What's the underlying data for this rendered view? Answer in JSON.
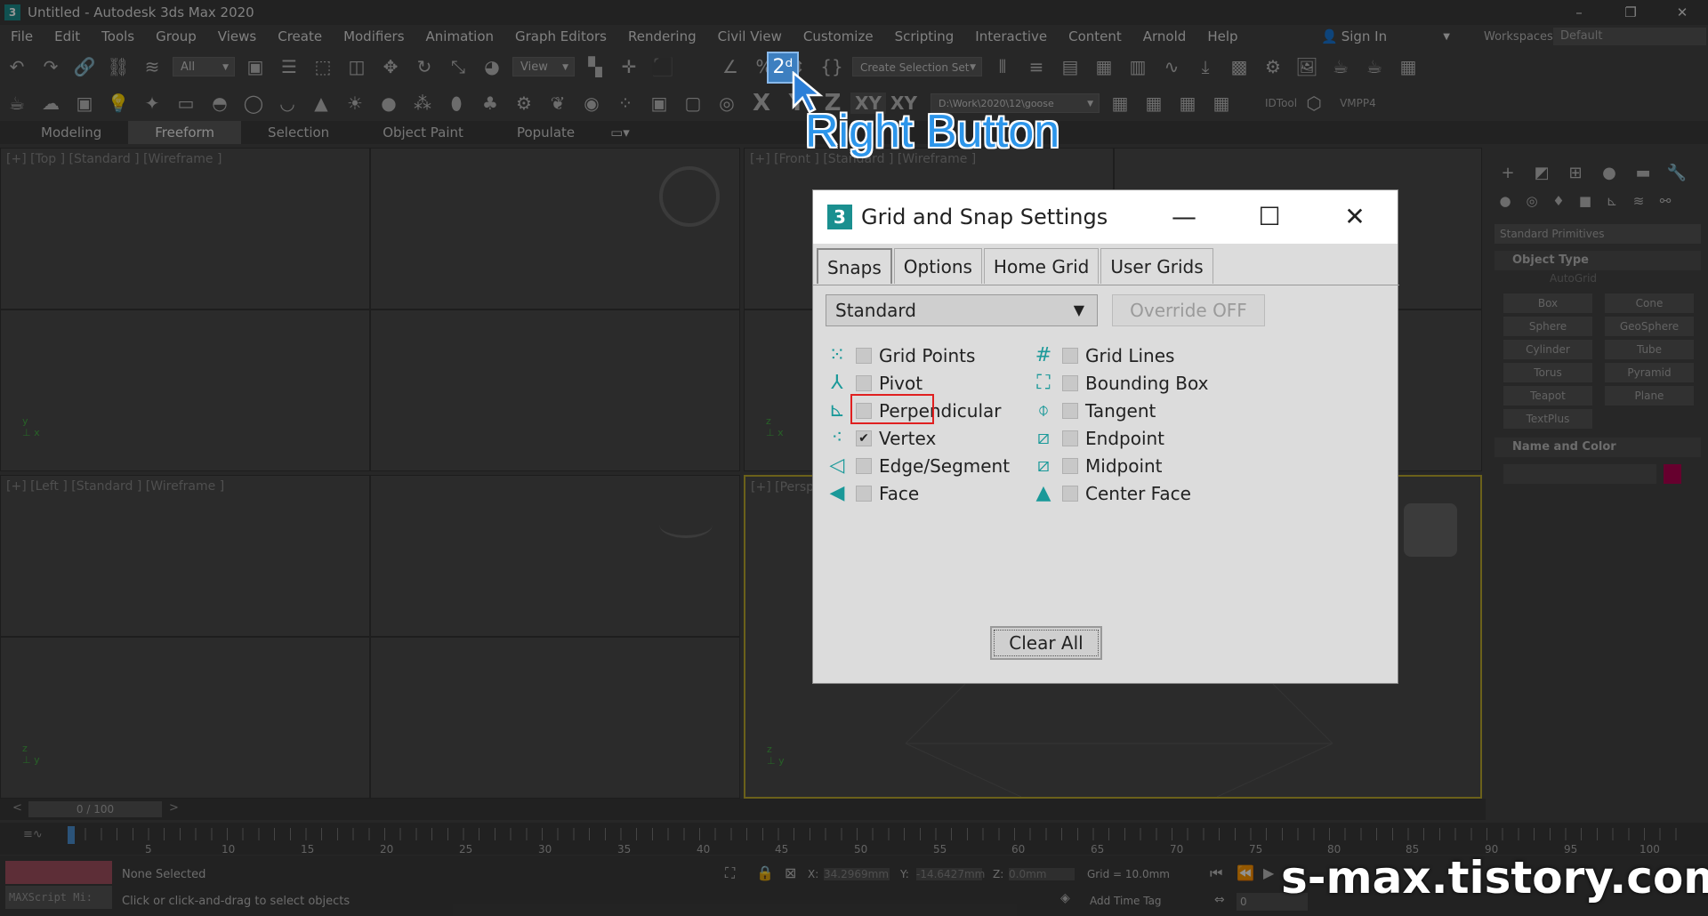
{
  "window": {
    "title": "Untitled - Autodesk 3ds Max 2020",
    "logo": "3"
  },
  "menu": [
    "File",
    "Edit",
    "Tools",
    "Group",
    "Views",
    "Create",
    "Modifiers",
    "Animation",
    "Graph Editors",
    "Rendering",
    "Civil View",
    "Customize",
    "Scripting",
    "Interactive",
    "Content",
    "Arnold",
    "Help"
  ],
  "signin": "Sign In",
  "workspaces_label": "Workspaces:",
  "workspace_value": "Default",
  "toolbar": {
    "filter": "All",
    "refcoord": "View",
    "selset": "Create Selection Set",
    "path": "D:\\Work\\2020\\12\\goose",
    "idtool": "IDTool",
    "vmpp4": "VMPP4",
    "snap_icon": "2ᵈ",
    "axis_labels": [
      "X",
      "Y",
      "Z",
      "XY",
      "XY"
    ]
  },
  "ribbon": [
    "Modeling",
    "Freeform",
    "Selection",
    "Object Paint",
    "Populate"
  ],
  "viewports": {
    "top": "[+] [Top ] [Standard ] [Wireframe ]",
    "front": "[+] [Front ] [Standard ] [Wireframe ]",
    "left": "[+] [Left ] [Standard ] [Wireframe ]",
    "persp": "[+] [Persp"
  },
  "annotation": {
    "label": "Right Button"
  },
  "dialog": {
    "title": "Grid and Snap Settings",
    "tabs": [
      "Snaps",
      "Options",
      "Home Grid",
      "User Grids"
    ],
    "dropdown": "Standard",
    "override": "Override OFF",
    "left_options": [
      {
        "label": "Grid Points",
        "checked": false
      },
      {
        "label": "Pivot",
        "checked": false
      },
      {
        "label": "Perpendicular",
        "checked": false
      },
      {
        "label": "Vertex",
        "checked": true
      },
      {
        "label": "Edge/Segment",
        "checked": false
      },
      {
        "label": "Face",
        "checked": false
      }
    ],
    "right_options": [
      {
        "label": "Grid Lines",
        "checked": false
      },
      {
        "label": "Bounding Box",
        "checked": false
      },
      {
        "label": "Tangent",
        "checked": false
      },
      {
        "label": "Endpoint",
        "checked": false
      },
      {
        "label": "Midpoint",
        "checked": false
      },
      {
        "label": "Center Face",
        "checked": false
      }
    ],
    "clear_all": "Clear All"
  },
  "command_panel": {
    "dropdown": "Standard Primitives",
    "object_type": "Object Type",
    "autogrid": "AutoGrid",
    "buttons": [
      "Box",
      "Cone",
      "Sphere",
      "GeoSphere",
      "Cylinder",
      "Tube",
      "Torus",
      "Pyramid",
      "Teapot",
      "Plane",
      "TextPlus"
    ],
    "name_color": "Name and Color",
    "swatch_color": "#b00050"
  },
  "timeline": {
    "frame": "0 / 100",
    "ticks": [
      "5",
      "10",
      "15",
      "20",
      "25",
      "30",
      "35",
      "40",
      "45",
      "50",
      "55",
      "60",
      "65",
      "70",
      "75",
      "80",
      "85",
      "90",
      "95",
      "100"
    ]
  },
  "status": {
    "selected": "None Selected",
    "hint": "Click or click-and-drag to select objects",
    "maxscript": "MAXScript Mi:",
    "x": "34.2969mm",
    "y": "-14.6427mm",
    "z": "0.0mm",
    "grid": "Grid = 10.0mm",
    "addtimetag": "Add Time Tag",
    "frame_field": "0"
  },
  "watermark": "s-max.tistory.com"
}
